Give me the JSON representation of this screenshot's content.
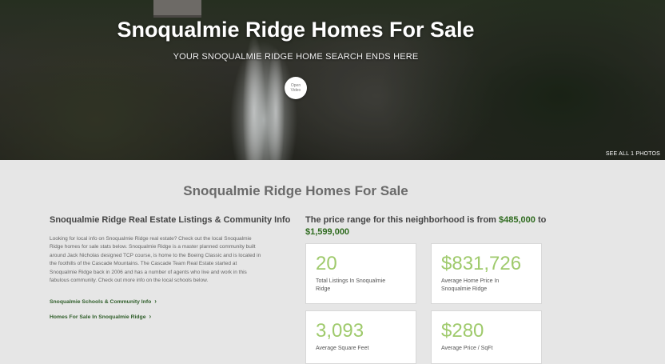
{
  "hero": {
    "title": "Snoqualmie Ridge Homes For Sale",
    "subtitle": "YOUR SNOQUALMIE RIDGE HOME SEARCH ENDS HERE",
    "video_button": {
      "line1": "Open",
      "line2": "Video"
    },
    "see_photos": "SEE ALL 1 PHOTOS"
  },
  "section_title": "Snoqualmie Ridge Homes For Sale",
  "left": {
    "heading": "Snoqualmie Ridge Real Estate Listings & Community Info",
    "lines": [
      "Looking for local info on Snoqualmie Ridge real estate? Check out the local Snoqualmie",
      "Ridge homes for sale stats below. Snoqualmie Ridge is a master planned community built",
      "around Jack Nicholas designed TCP course, is home to the Boeing Classic and is located in",
      "the foothills of the Cascade Mountains. The Cascade Team Real Estate started at",
      "Snoqualmie Ridge back in 2006 and has a number of agents who live and work in this",
      "fabulous community. Check out more info on the local schools below."
    ],
    "links": [
      {
        "label": "Snoqualmie Schools & Community Info"
      },
      {
        "label": "Homes For Sale In Snoqualmie Ridge"
      }
    ]
  },
  "price_range": {
    "prefix": "The price range for this neighborhood is from ",
    "min": "$485,000",
    "middle": " to ",
    "max": "$1,599,000"
  },
  "stats": [
    {
      "value": "20",
      "label_line1": "Total Listings In Snoqualmie",
      "label_line2": "Ridge"
    },
    {
      "value": "$831,726",
      "label_line1": "Average Home Price In",
      "label_line2": "Snoqualmie Ridge"
    },
    {
      "value": "3,093",
      "label_line1": "Average Square Feet",
      "label_line2": ""
    },
    {
      "value": "$280",
      "label_line1": "Average Price / SqFt",
      "label_line2": ""
    }
  ],
  "colors": {
    "stat_value": "#9fca6c",
    "price_accent": "#2f6b1f",
    "link": "#2f5e2a"
  }
}
